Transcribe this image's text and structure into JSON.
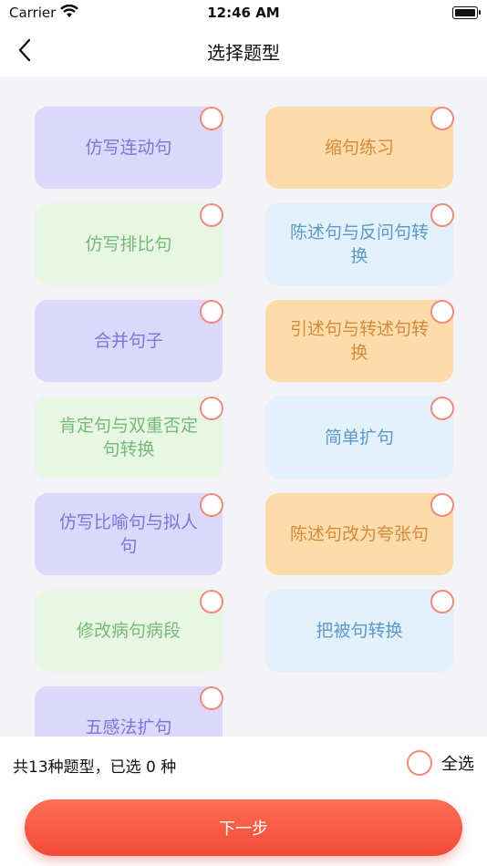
{
  "status_bar": {
    "carrier": "Carrier",
    "time": "12:46 AM"
  },
  "nav": {
    "title": "选择题型",
    "back_icon": "chevron-left-icon"
  },
  "question_types": [
    {
      "label": "仿写连动句",
      "color": "purple",
      "selected": false
    },
    {
      "label": "缩句练习",
      "color": "orange",
      "selected": false
    },
    {
      "label": "仿写排比句",
      "color": "green",
      "selected": false
    },
    {
      "label": "陈述句与反问句转换",
      "color": "blue",
      "selected": false
    },
    {
      "label": "合并句子",
      "color": "purple",
      "selected": false
    },
    {
      "label": "引述句与转述句转换",
      "color": "orange",
      "selected": false
    },
    {
      "label": "肯定句与双重否定句转换",
      "color": "green",
      "selected": false
    },
    {
      "label": "简单扩句",
      "color": "blue",
      "selected": false
    },
    {
      "label": "仿写比喻句与拟人句",
      "color": "purple",
      "selected": false
    },
    {
      "label": "陈述句改为夸张句",
      "color": "orange",
      "selected": false
    },
    {
      "label": "修改病句病段",
      "color": "green",
      "selected": false
    },
    {
      "label": "把被句转换",
      "color": "blue",
      "selected": false
    },
    {
      "label": "五感法扩句",
      "color": "purple",
      "selected": false
    }
  ],
  "footer": {
    "count_text": "共13种题型，已选 0 种",
    "select_all_label": "全选",
    "next_button_label": "下一步"
  },
  "colors": {
    "accent": "#f24a3a",
    "radio_border": "#ef8a7c",
    "content_bg": "#f4f4f8"
  }
}
